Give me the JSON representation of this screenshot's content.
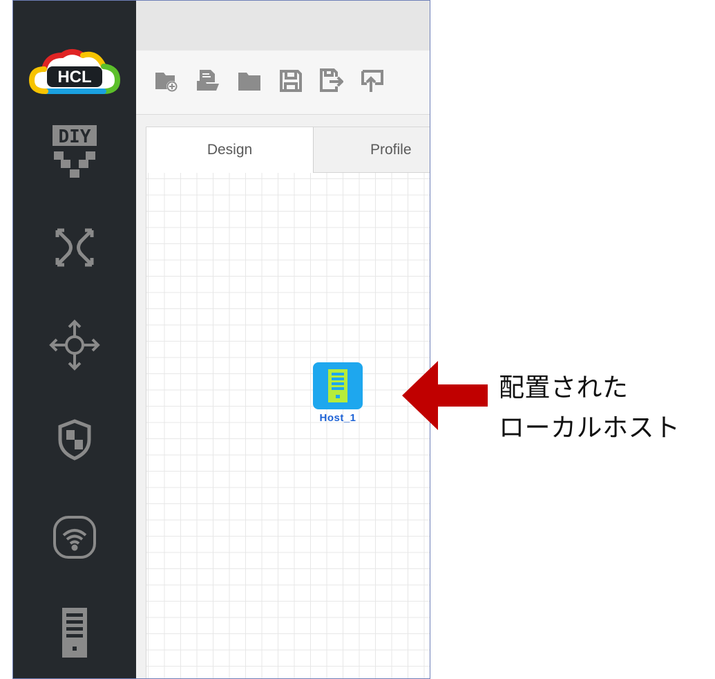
{
  "sidebar": {
    "logo_text": "HCL",
    "items": [
      {
        "icon": "diy-icon",
        "label": "DIY"
      },
      {
        "icon": "switch-icon"
      },
      {
        "icon": "router-icon"
      },
      {
        "icon": "firewall-shield-icon"
      },
      {
        "icon": "wireless-icon"
      },
      {
        "icon": "host-server-icon"
      }
    ]
  },
  "toolbar": {
    "buttons": [
      {
        "icon": "new-folder-icon"
      },
      {
        "icon": "open-file-icon"
      },
      {
        "icon": "open-folder-icon"
      },
      {
        "icon": "save-icon"
      },
      {
        "icon": "save-as-icon"
      },
      {
        "icon": "export-icon"
      }
    ]
  },
  "tabs": [
    {
      "label": "Design",
      "active": true
    },
    {
      "label": "Profile",
      "active": false
    }
  ],
  "canvas": {
    "nodes": [
      {
        "label": "Host_1",
        "icon": "host-server-icon",
        "color": "#1ea7ee",
        "label_color": "#1e63d6"
      }
    ]
  },
  "annotation": {
    "line1": "配置された",
    "line2": "ローカルホスト",
    "arrow_color": "#c00000"
  }
}
